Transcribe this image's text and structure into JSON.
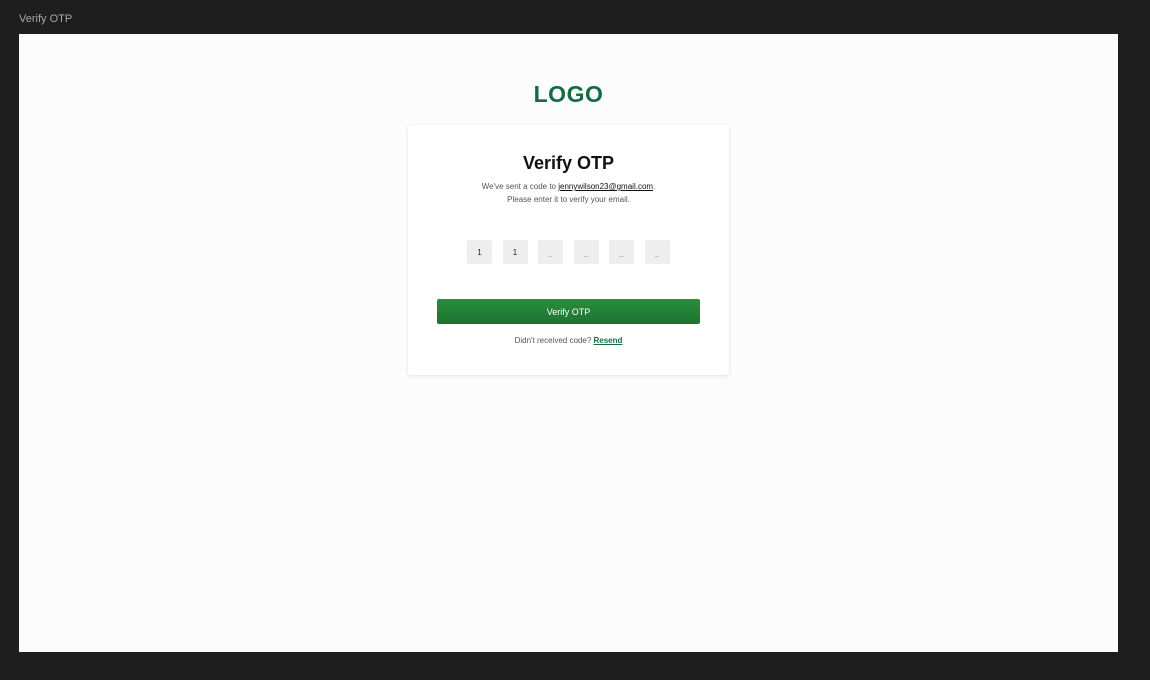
{
  "window": {
    "frame_label": "Verify OTP"
  },
  "brand": {
    "logo_text": "LOGO",
    "accent_color": "#116b43",
    "button_color": "#1f7a34"
  },
  "card": {
    "title": "Verify OTP",
    "desc_prefix": "We've sent a code to ",
    "email": "jennywilson23@gmail.com",
    "desc_suffix": ".",
    "desc_line2": "Please enter it to verify your email."
  },
  "otp": {
    "digits": [
      "1",
      "1",
      "_",
      "_",
      "_",
      "_"
    ]
  },
  "actions": {
    "verify_label": "Verify OTP",
    "resend_prompt": "Didn't received code?",
    "resend_label": "Resend"
  }
}
